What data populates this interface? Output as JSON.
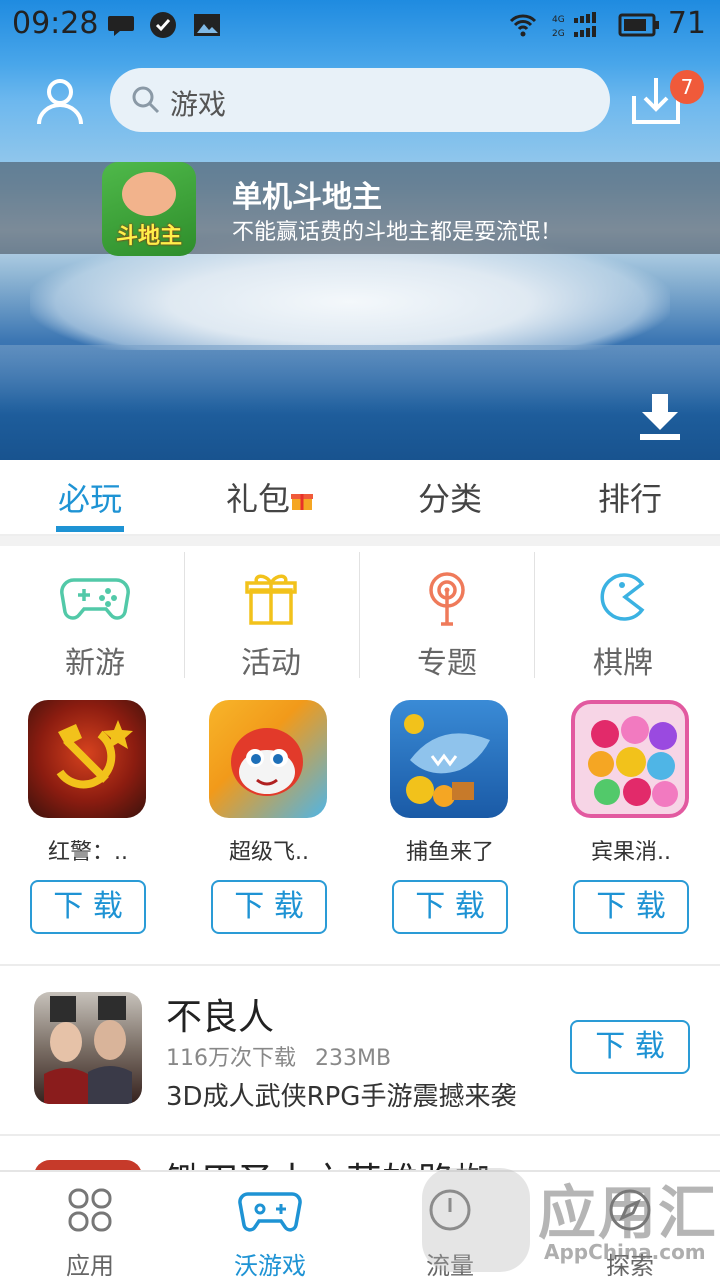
{
  "status_bar": {
    "time": "09:28",
    "battery": "71",
    "network_label_top": "4G",
    "network_label_bottom": "2G"
  },
  "header": {
    "search_placeholder": "游戏",
    "download_badge": "7"
  },
  "promo": {
    "app_icon_label": "斗地主",
    "title": "单机斗地主",
    "subtitle": "不能赢话费的斗地主都是耍流氓！"
  },
  "tabs": [
    {
      "label": "必玩",
      "active": true
    },
    {
      "label": "礼包",
      "active": false
    },
    {
      "label": "分类",
      "active": false
    },
    {
      "label": "排行",
      "active": false
    }
  ],
  "categories": [
    {
      "label": "新游",
      "icon": "gamepad-icon",
      "color": "#52c9a8"
    },
    {
      "label": "活动",
      "icon": "gift-icon",
      "color": "#f2c21b"
    },
    {
      "label": "专题",
      "icon": "antenna-icon",
      "color": "#ef7a5a"
    },
    {
      "label": "棋牌",
      "icon": "pacman-icon",
      "color": "#3bb2e2"
    }
  ],
  "games": [
    {
      "name": "红警：..",
      "button": "下 载"
    },
    {
      "name": "超级飞..",
      "button": "下 载"
    },
    {
      "name": "捕鱼来了",
      "button": "下 载"
    },
    {
      "name": "宾果消..",
      "button": "下 载"
    }
  ],
  "list_item": {
    "name": "不良人",
    "downloads": "116万次下载",
    "size": "233MB",
    "description": "3D成人武侠RPG手游震撼来袭",
    "button": "下 载"
  },
  "next_item_partial": "锄田圣十之英雄路蜘",
  "bottom_nav": [
    {
      "label": "应用",
      "active": false
    },
    {
      "label": "沃游戏",
      "active": true
    },
    {
      "label": "流量",
      "active": false
    },
    {
      "label": "探索",
      "active": false
    }
  ],
  "watermark": {
    "big": "应用汇",
    "small": "AppChina.com"
  },
  "colors": {
    "accent": "#1e93d4",
    "badge": "#f05a3a"
  }
}
